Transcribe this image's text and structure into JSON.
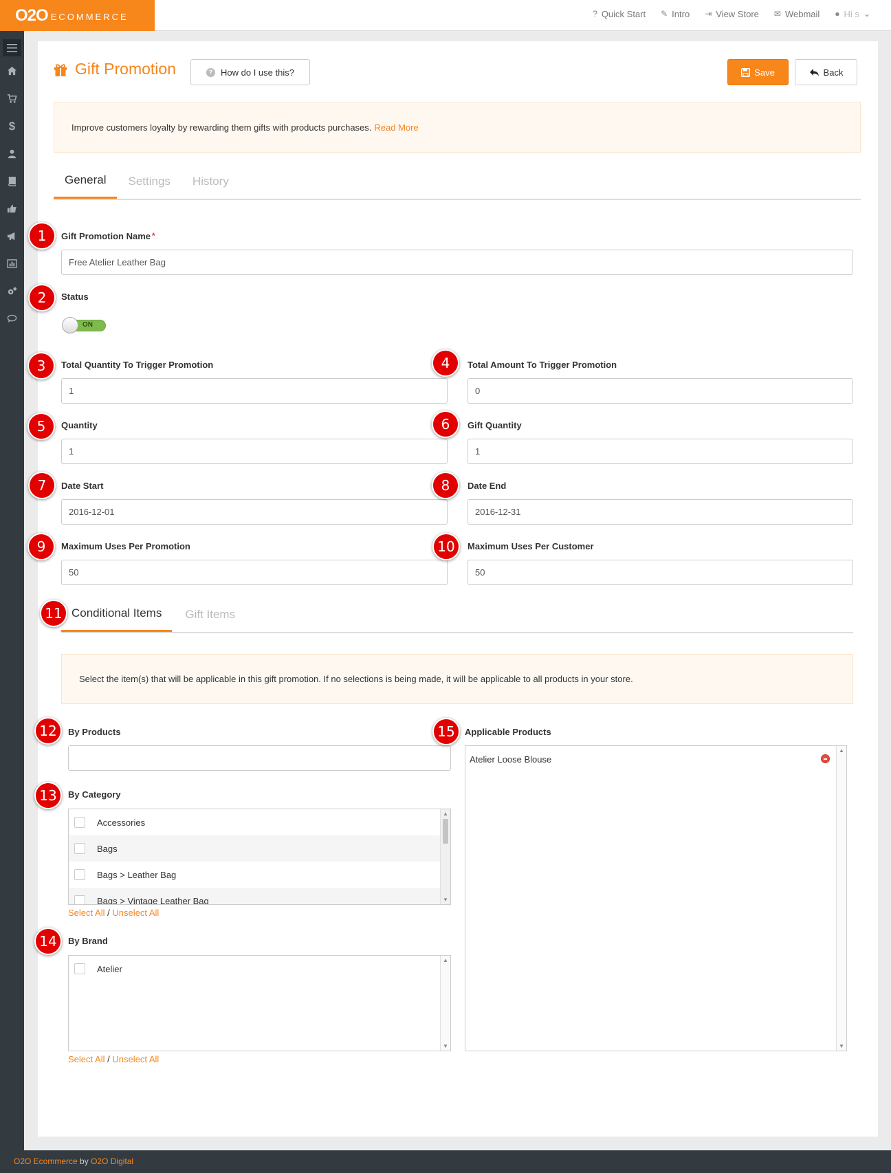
{
  "brand": {
    "name": "O2O",
    "sub": "ECOMMERCE"
  },
  "topnav": {
    "quick_start": "Quick Start",
    "intro": "Intro",
    "view_store": "View Store",
    "webmail": "Webmail",
    "user": "Hi s"
  },
  "page": {
    "title": "Gift Promotion",
    "help_label": "How do I use this?",
    "save_label": "Save",
    "back_label": "Back",
    "intro_text": "Improve customers loyalty by rewarding them gifts with products purchases.",
    "read_more": "Read More"
  },
  "tabs": [
    "General",
    "Settings",
    "History"
  ],
  "form": {
    "name_label": "Gift Promotion Name",
    "name_required": "*",
    "name_value": "Free Atelier Leather Bag",
    "status_label": "Status",
    "status_value": "ON",
    "total_qty_label": "Total Quantity To Trigger Promotion",
    "total_qty_value": "1",
    "total_amount_label": "Total Amount To Trigger Promotion",
    "total_amount_value": "0",
    "qty_label": "Quantity",
    "qty_value": "1",
    "gift_qty_label": "Gift Quantity",
    "gift_qty_value": "1",
    "date_start_label": "Date Start",
    "date_start_value": "2016-12-01",
    "date_end_label": "Date End",
    "date_end_value": "2016-12-31",
    "max_uses_promo_label": "Maximum Uses Per Promotion",
    "max_uses_promo_value": "50",
    "max_uses_customer_label": "Maximum Uses Per Customer",
    "max_uses_customer_value": "50"
  },
  "subtabs": [
    "Conditional Items",
    "Gift Items"
  ],
  "conditional": {
    "info_text": "Select the item(s) that will be applicable in this gift promotion. If no selections is being made, it will be applicable to all products in your store.",
    "by_products_label": "By Products",
    "by_products_value": "",
    "by_category_label": "By Category",
    "categories": [
      "Accessories",
      "Bags",
      "Bags > Leather Bag",
      "Bags > Vintage Leather Bag"
    ],
    "by_brand_label": "By Brand",
    "brands": [
      "Atelier"
    ],
    "select_all": "Select All",
    "separator": "/",
    "unselect_all": "Unselect All",
    "applicable_label": "Applicable Products",
    "applicable_products": [
      "Atelier Loose Blouse"
    ]
  },
  "badges": [
    "1",
    "2",
    "3",
    "4",
    "5",
    "6",
    "7",
    "8",
    "9",
    "10",
    "11",
    "12",
    "13",
    "14",
    "15"
  ],
  "footer": {
    "brand": "O2O Ecommerce",
    "by": "by",
    "company": "O2O Digital"
  },
  "colors": {
    "accent": "#f7861b",
    "sidebar": "#333b41",
    "badge": "#e20000",
    "toggle_on": "#7fba4d"
  }
}
